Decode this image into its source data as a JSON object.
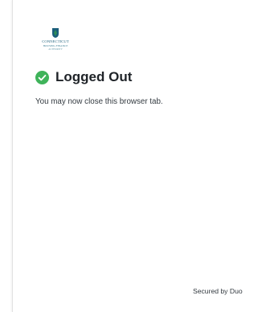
{
  "brand": {
    "logo_lines": [
      "CONNECTICUT",
      "HOUSING FINANCE",
      "AUTHORITY",
      ""
    ],
    "colors": {
      "logo_primary": "#1b5e7a",
      "logo_accent": "#2e8b57"
    }
  },
  "status": {
    "icon": "check-circle-icon",
    "icon_color": "#3fb35a",
    "title": "Logged Out",
    "message": "You may now close this browser tab."
  },
  "footer": {
    "text": "Secured by Duo"
  }
}
